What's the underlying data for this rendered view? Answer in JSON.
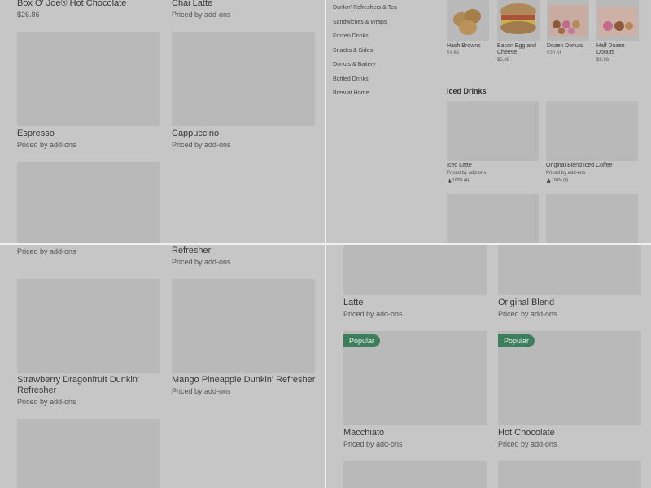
{
  "top_left": {
    "items": [
      {
        "name": "Box O' Joe® Hot Chocolate",
        "sub": "$26.86"
      },
      {
        "name": "Chai Latte",
        "sub": "Priced by add-ons"
      },
      {
        "name": "Espresso",
        "sub": "Priced by add-ons"
      },
      {
        "name": "Cappuccino",
        "sub": "Priced by add-ons"
      }
    ]
  },
  "top_right": {
    "categories": [
      "Dunkin' Refreshers & Tea",
      "Sandwiches & Wraps",
      "Frozen Drinks",
      "Snacks & Sides",
      "Donuts & Bakery",
      "Bottled Drinks",
      "Brew at Home"
    ],
    "top_items": [
      {
        "name": "Hash Browns",
        "price": "$1.86"
      },
      {
        "name": "Bacon Egg and Cheese",
        "price": "$5.36"
      },
      {
        "name": "Dozen Donuts",
        "price": "$20.61"
      },
      {
        "name": "Half Dozen Donuts",
        "price": "$9.98"
      }
    ],
    "section_title": "Iced Drinks",
    "iced_items": [
      {
        "name": "Iced Latte",
        "sub": "Priced by add-ons",
        "rating": "100% (4)"
      },
      {
        "name": "Original Blend Iced Coffee",
        "sub": "Priced by add-ons",
        "rating": "100% (6)"
      }
    ]
  },
  "bottom_left": {
    "items": [
      {
        "name": "",
        "sub": "Priced by add-ons"
      },
      {
        "name": "Refresher",
        "sub": "Priced by add-ons"
      },
      {
        "name": "Strawberry Dragonfruit Dunkin' Refresher",
        "sub": "Priced by add-ons"
      },
      {
        "name": "Mango Pineapple Dunkin' Refresher",
        "sub": "Priced by add-ons"
      }
    ]
  },
  "bottom_right": {
    "badge_label": "Popular",
    "items": [
      {
        "name": "Latte",
        "sub": "Priced by add-ons"
      },
      {
        "name": "Original Blend",
        "sub": "Priced by add-ons"
      },
      {
        "name": "Macchiato",
        "sub": "Priced by add-ons"
      },
      {
        "name": "Hot Chocolate",
        "sub": "Priced by add-ons"
      }
    ]
  },
  "colors": {
    "overlay": "#c6c6c6",
    "placeholder": "#b9b9b9",
    "badge": "#3d7f5c"
  }
}
